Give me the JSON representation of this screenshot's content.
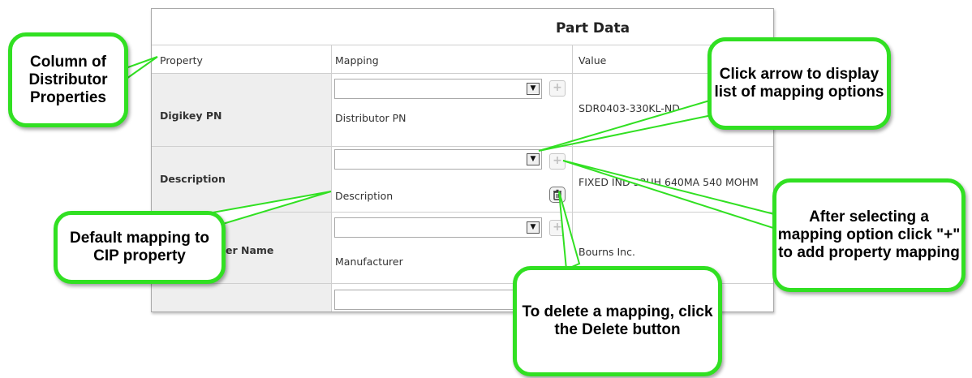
{
  "panel": {
    "title": "Part Data",
    "headers": {
      "property": "Property",
      "mapping": "Mapping",
      "value": "Value"
    },
    "rows": [
      {
        "property": "Digikey PN",
        "selected": "",
        "mapping_label": "Distributor PN",
        "value": "SDR0403-330KL-ND"
      },
      {
        "property": "Description",
        "selected": "",
        "mapping_label": "Description",
        "value": "FIXED IND 33UH 640MA 540 MOHM"
      },
      {
        "property": "Manufacturer Name",
        "selected": "",
        "mapping_label": "Manufacturer",
        "value": "Bourns Inc."
      }
    ],
    "add_button_glyph": "+",
    "dropdown_glyph": "▼"
  },
  "callouts": {
    "distributor_props": "Column of Distributor Properties",
    "click_arrow": "Click arrow to display list of mapping options",
    "after_selecting": "After selecting a mapping option click \"+\" to add property mapping",
    "default_mapping": "Default mapping to CIP property",
    "delete_mapping": "To delete a mapping, click the Delete button"
  },
  "icons": {
    "add": "plus-icon",
    "delete": "trash-icon",
    "dropdown": "chevron-down-icon"
  },
  "colors": {
    "callout_border": "#31e022",
    "row_shade": "#eeeeee",
    "grid": "#cfcfcf"
  }
}
